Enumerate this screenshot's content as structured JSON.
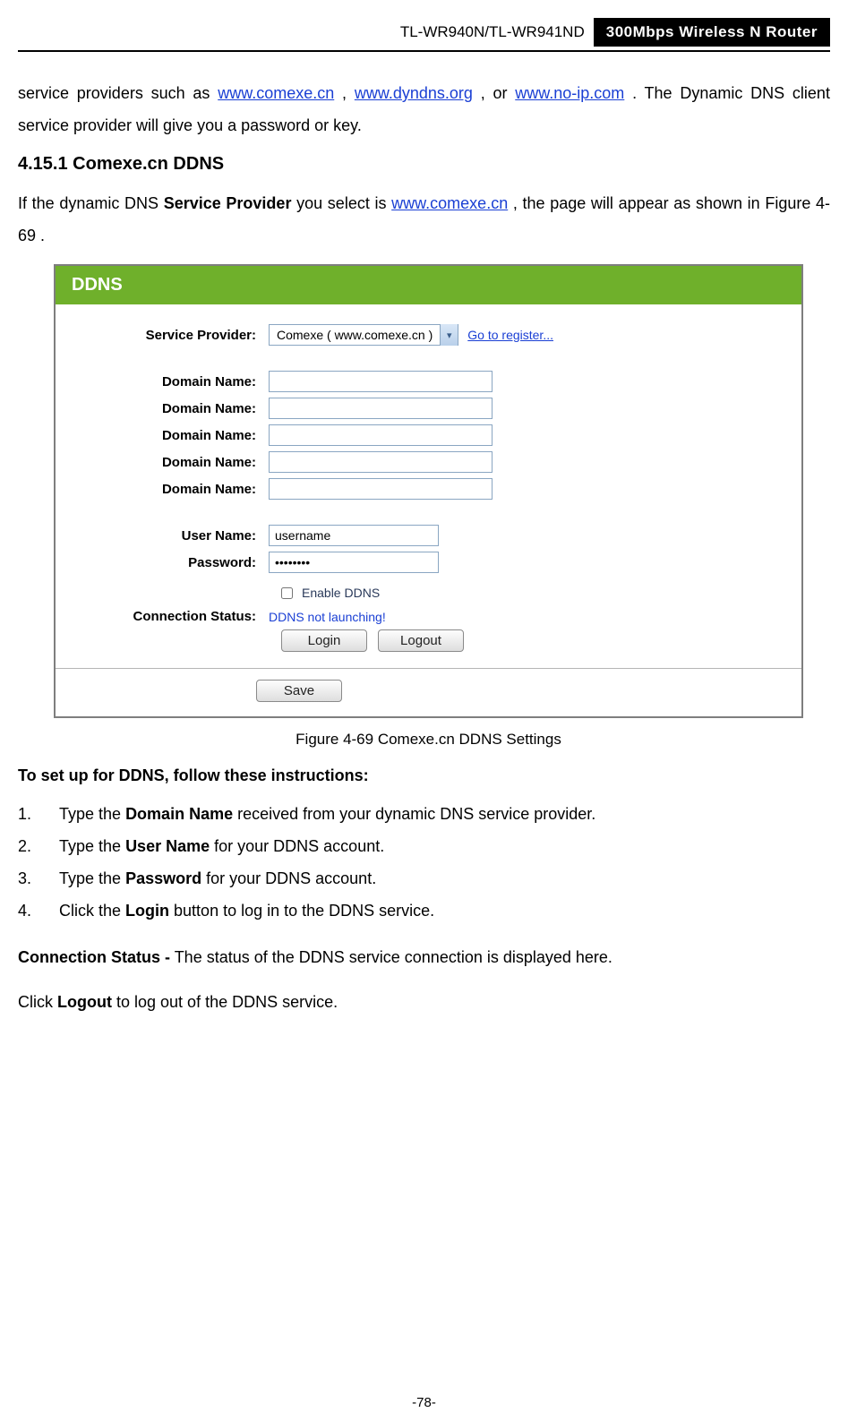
{
  "header": {
    "model": "TL-WR940N/TL-WR941ND",
    "product": "300Mbps Wireless N Router"
  },
  "intro": {
    "prefix": "service providers such as ",
    "link1": "www.comexe.cn",
    "mid1": ", ",
    "link2": "www.dyndns.org",
    "mid2": ", or ",
    "link3": "www.no-ip.com",
    "suffix": ". The Dynamic DNS client service provider will give you a password or key."
  },
  "section_heading": "4.15.1 Comexe.cn DDNS",
  "section_para": {
    "p1a": "If the dynamic DNS ",
    "bold1": "Service Provider",
    "p1b": " you select is ",
    "link": "www.comexe.cn",
    "p1c": ", the page will appear as shown in ",
    "figref": "Figure 4-69",
    "p1d": "."
  },
  "panel": {
    "title": "DDNS",
    "labels": {
      "service_provider": "Service Provider:",
      "domain_name": "Domain Name:",
      "user_name": "User Name:",
      "password": "Password:",
      "connection_status": "Connection Status:"
    },
    "service_provider_value": "Comexe ( www.comexe.cn )",
    "go_register": "Go to register...",
    "user_name_value": "username",
    "password_value": "••••••••",
    "enable_ddns_label": "Enable DDNS",
    "status_text": "DDNS not launching!",
    "login_btn": "Login",
    "logout_btn": "Logout",
    "save_btn": "Save"
  },
  "figure_caption": "Figure 4-69 Comexe.cn DDNS Settings",
  "instructions_heading": "To set up for DDNS, follow these instructions:",
  "steps": [
    {
      "pre": "Type the ",
      "bold": "Domain Name",
      "post": " received from your dynamic DNS service provider."
    },
    {
      "pre": "Type the ",
      "bold": "User Name",
      "post": " for your DDNS account."
    },
    {
      "pre": "Type the ",
      "bold": "Password",
      "post": " for your DDNS account."
    },
    {
      "pre": "Click the ",
      "bold": "Login",
      "post": " button to log in to the DDNS service."
    }
  ],
  "conn_status_line": {
    "bold": "Connection Status -",
    "rest": "The status of the DDNS service connection is displayed here."
  },
  "logout_line": {
    "pre": "Click ",
    "bold": "Logout",
    "post": " to log out of the DDNS service."
  },
  "page_number": "-78-"
}
